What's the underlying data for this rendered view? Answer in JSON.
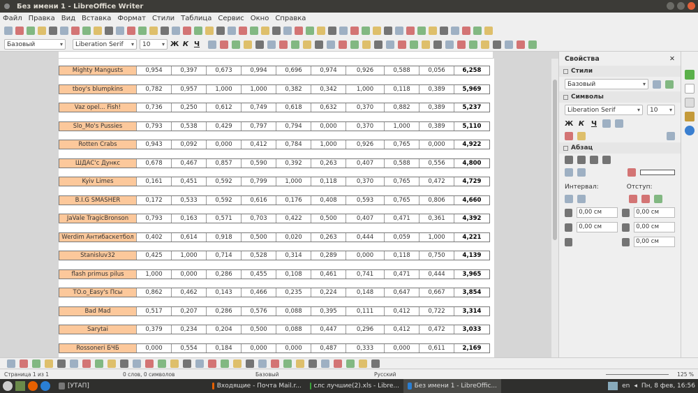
{
  "window": {
    "title": "Без имени 1 - LibreOffice Writer"
  },
  "menu": [
    "Файл",
    "Правка",
    "Вид",
    "Вставка",
    "Формат",
    "Стили",
    "Таблица",
    "Сервис",
    "Окно",
    "Справка"
  ],
  "formatting": {
    "style": "Базовый",
    "font": "Liberation Serif",
    "size": "10",
    "bold": "Ж",
    "italic": "К",
    "underline": "Ч"
  },
  "table": {
    "rows": [
      [
        "Mighty Mangusts",
        "0,954",
        "0,397",
        "0,673",
        "0,994",
        "0,696",
        "0,974",
        "0,926",
        "0,588",
        "0,056",
        "6,258"
      ],
      [
        "tboy's blumpkins",
        "0,782",
        "0,957",
        "1,000",
        "1,000",
        "0,382",
        "0,342",
        "1,000",
        "0,118",
        "0,389",
        "5,969"
      ],
      [
        "Vaz opel... Fish!",
        "0,736",
        "0,250",
        "0,612",
        "0,749",
        "0,618",
        "0,632",
        "0,370",
        "0,882",
        "0,389",
        "5,237"
      ],
      [
        "Slo_Mo's Pussies",
        "0,793",
        "0,538",
        "0,429",
        "0,797",
        "0,794",
        "0,000",
        "0,370",
        "1,000",
        "0,389",
        "5,110"
      ],
      [
        "Rotten Crabs",
        "0,943",
        "0,092",
        "0,000",
        "0,412",
        "0,784",
        "1,000",
        "0,926",
        "0,765",
        "0,000",
        "4,922"
      ],
      [
        "ШДАС'с Дункс",
        "0,678",
        "0,467",
        "0,857",
        "0,590",
        "0,392",
        "0,263",
        "0,407",
        "0,588",
        "0,556",
        "4,800"
      ],
      [
        "Kyiv Limes",
        "0,161",
        "0,451",
        "0,592",
        "0,799",
        "1,000",
        "0,118",
        "0,370",
        "0,765",
        "0,472",
        "4,729"
      ],
      [
        "B.I.G SMASHER",
        "0,172",
        "0,533",
        "0,592",
        "0,616",
        "0,176",
        "0,408",
        "0,593",
        "0,765",
        "0,806",
        "4,660"
      ],
      [
        "JaVale TragicBronson",
        "0,793",
        "0,163",
        "0,571",
        "0,703",
        "0,422",
        "0,500",
        "0,407",
        "0,471",
        "0,361",
        "4,392"
      ],
      [
        "Werdim Антибаскетбол",
        "0,402",
        "0,614",
        "0,918",
        "0,500",
        "0,020",
        "0,263",
        "0,444",
        "0,059",
        "1,000",
        "4,221"
      ],
      [
        "Stanisluv32",
        "0,425",
        "1,000",
        "0,714",
        "0,528",
        "0,314",
        "0,289",
        "0,000",
        "0,118",
        "0,750",
        "4,139"
      ],
      [
        "flash primus pilus",
        "1,000",
        "0,000",
        "0,286",
        "0,455",
        "0,108",
        "0,461",
        "0,741",
        "0,471",
        "0,444",
        "3,965"
      ],
      [
        "TO.o_Easy's Псы",
        "0,862",
        "0,462",
        "0,143",
        "0,466",
        "0,235",
        "0,224",
        "0,148",
        "0,647",
        "0,667",
        "3,854"
      ],
      [
        "Bad Mad",
        "0,517",
        "0,207",
        "0,286",
        "0,576",
        "0,088",
        "0,395",
        "0,111",
        "0,412",
        "0,722",
        "3,314"
      ],
      [
        "Sarytai",
        "0,379",
        "0,234",
        "0,204",
        "0,500",
        "0,088",
        "0,447",
        "0,296",
        "0,412",
        "0,472",
        "3,033"
      ],
      [
        "Rossoneri БЧБ",
        "0,000",
        "0,554",
        "0,184",
        "0,000",
        "0,000",
        "0,487",
        "0,333",
        "0,000",
        "0,611",
        "2,169"
      ]
    ]
  },
  "sidebar": {
    "title": "Свойства",
    "styles_section": "Стили",
    "style_value": "Базовый",
    "chars_section": "Символы",
    "font": "Liberation Serif",
    "size": "10",
    "para_section": "Абзац",
    "spacing_label": "Интервал:",
    "indent_label": "Отступ:",
    "above": "0,00 см",
    "below": "0,00 см",
    "indent_before": "0,00 см",
    "indent_after": "0,00 см",
    "first_line": "0,00 см"
  },
  "status": {
    "page": "Страница 1 из 1",
    "words": "0 слов, 0 символов",
    "style": "Базовый",
    "lang": "Русский",
    "zoom": "125 %"
  },
  "taskbar": {
    "items": [
      "[УТАП]",
      "Входящие - Почта Mail.r...",
      "слс лучшие(2).xls - Libre...",
      "Без имени 1 - LibreOffic..."
    ],
    "lang": "en",
    "clock": "Пн, 8 фев, 16:56"
  }
}
